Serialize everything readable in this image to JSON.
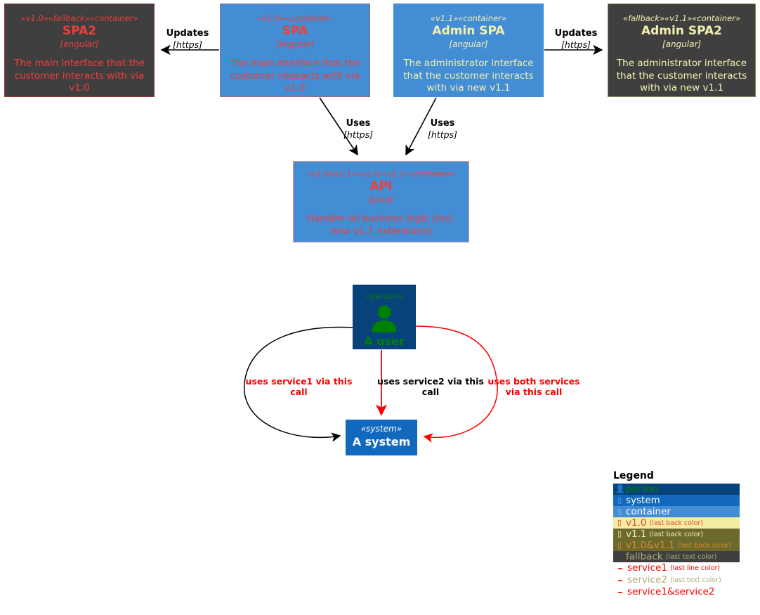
{
  "diagram": {
    "nodes": [
      {
        "id": "spa2",
        "stereotypes": "« v1.0 »« fallback »« container »",
        "stereotypes_text": "«v1.0»«fallback»«container»",
        "title": "SPA2",
        "tech": "[angular]",
        "description": "The main interface that the customer interacts with via v1.0",
        "back_color": "#3f3f3f",
        "text_color": "#ee3f3a",
        "border_color": "#8f3b38"
      },
      {
        "id": "spa",
        "stereotypes_text": "«v1.0»«container»",
        "title": "SPA",
        "tech": "[angular]",
        "description": "The main interface that the customer interacts with via v1.0",
        "back_color": "#438dd5",
        "text_color": "#ee3f3a",
        "border_color": "#9b6a86"
      },
      {
        "id": "admin-spa",
        "stereotypes_text": "«v1.1»«container»",
        "title": "Admin SPA",
        "tech": "[angular]",
        "description": "The administrator interface that the customer interacts with via new v1.1",
        "back_color": "#438dd5",
        "text_color": "#f4f0b0",
        "border_color": "#438dd5"
      },
      {
        "id": "admin-spa2",
        "stereotypes_text": "«fallback»«v1.1»«container»",
        "title": "Admin SPA2",
        "tech": "[angular]",
        "description": "The administrator interface that the customer interacts with via new v1.1",
        "back_color": "#3f3f3f",
        "text_color": "#f4f0b0",
        "border_color": "#8a8350"
      },
      {
        "id": "api",
        "stereotypes_text": "«v1.0&v1.1»«v1.0»«v1.1»«container»",
        "title": "API",
        "tech": "[java]",
        "description": "Handles all business logic (incl. new v1.1 extensions)",
        "back_color": "#438dd5",
        "text_color": "#ee3f3a",
        "border_color": "#e09a95"
      },
      {
        "id": "person",
        "stereotypes_text": "«person»",
        "title": "A user",
        "back_color": "#08427b",
        "text_color": "#008000"
      },
      {
        "id": "system",
        "stereotypes_text": "«system»",
        "title": "A system",
        "back_color": "#1168bd",
        "text_color": "#ffffff"
      }
    ],
    "edges": [
      {
        "id": "spa-updates-spa2",
        "label": "Updates",
        "tech": "[https]",
        "color": "#000000"
      },
      {
        "id": "spa-uses-api",
        "label": "Uses",
        "tech": "[https]",
        "color": "#000000"
      },
      {
        "id": "adminspa-uses-api",
        "label": "Uses",
        "tech": "[https]",
        "color": "#000000"
      },
      {
        "id": "adminspa-updates-adminspa2",
        "label": "Updates",
        "tech": "[https]",
        "color": "#000000"
      }
    ],
    "relations": [
      {
        "id": "service1",
        "line1": "uses service1 via this",
        "line2": "call",
        "color": "#ff0000",
        "line_color": "#000000"
      },
      {
        "id": "service2",
        "line1": "uses service2 via this",
        "line2": "call",
        "color": "#000000",
        "line_color": "#ff0000"
      },
      {
        "id": "both",
        "line1": "uses both services",
        "line2": "via this call",
        "color": "#ff0000",
        "line_color": "#ff0000"
      }
    ]
  },
  "legend": {
    "title": "Legend",
    "rows": [
      {
        "icon": "person-icon",
        "glyph": "▯",
        "name": "person",
        "note": "",
        "back": "#08427b",
        "text": "#008000",
        "swatch": "#4f7aa8"
      },
      {
        "icon": "system-icon",
        "glyph": "▯",
        "name": "system",
        "note": "",
        "back": "#1168bd",
        "text": "#ffffff",
        "swatch": "#6fa2d8"
      },
      {
        "icon": "container-icon",
        "glyph": "▯",
        "name": "container",
        "note": "",
        "back": "#438dd5",
        "text": "#ffffff",
        "swatch": "#8bb9e5"
      },
      {
        "icon": "v10-icon",
        "glyph": "▯",
        "name": "v1.0",
        "note": "(last back color)",
        "back": "#f2eda0",
        "text": "#ee3f3a",
        "swatch": "#ee3f3a"
      },
      {
        "icon": "v11-icon",
        "glyph": "▯",
        "name": "v1.1",
        "note": "(last back color)",
        "back": "#6b6a2c",
        "text": "#f4f0b0",
        "swatch": "#f4f0b0"
      },
      {
        "icon": "v10v11-icon",
        "glyph": "▯",
        "name": "v1.0&v1.1",
        "note": "(last back color)",
        "back": "#6b6a2c",
        "text": "#e08a30",
        "swatch": "#e08a30"
      },
      {
        "icon": "fallback-icon",
        "glyph": "",
        "name": "fallback",
        "note": "(last text color)",
        "back": "#3f3f3f",
        "text": "#b0ac78",
        "swatch": ""
      }
    ],
    "lines": [
      {
        "icon": "dash-icon",
        "name": "service1",
        "note": "(last line color)",
        "color": "#ff0000"
      },
      {
        "icon": "dash-icon",
        "name": "service2",
        "note": "(last text color)",
        "color": "#ff0000",
        "name_color": "#b0ac78"
      },
      {
        "icon": "dash-icon",
        "name": "service1&service2",
        "note": "",
        "color": "#ff0000"
      }
    ]
  }
}
